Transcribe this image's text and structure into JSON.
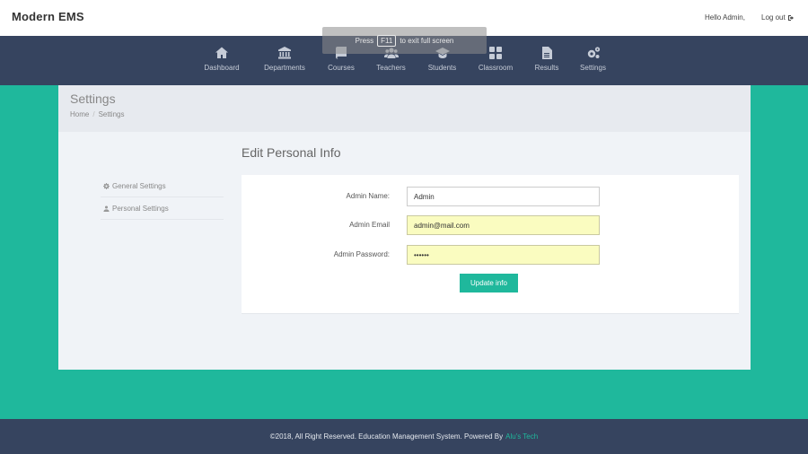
{
  "header": {
    "brand": "Modern EMS",
    "greeting": "Hello Admin,",
    "logout_label": "Log out",
    "logout_icon": "sign-out-icon"
  },
  "fullscreen_tip": {
    "prefix": "Press",
    "key": "F11",
    "suffix": "to exit full screen"
  },
  "nav": {
    "items": [
      {
        "label": "Dashboard",
        "icon": "home-icon"
      },
      {
        "label": "Departments",
        "icon": "institution-icon"
      },
      {
        "label": "Courses",
        "icon": "book-icon"
      },
      {
        "label": "Teachers",
        "icon": "users-icon"
      },
      {
        "label": "Students",
        "icon": "graduation-cap-icon"
      },
      {
        "label": "Classroom",
        "icon": "grid-icon"
      },
      {
        "label": "Results",
        "icon": "file-icon"
      },
      {
        "label": "Settings",
        "icon": "cogs-icon"
      }
    ]
  },
  "page": {
    "title": "Settings",
    "breadcrumb": [
      "Home",
      "/",
      "Settings"
    ]
  },
  "sidebar": {
    "items": [
      {
        "label": "General Settings",
        "icon": "gear-icon"
      },
      {
        "label": "Personal Settings",
        "icon": "user-icon"
      }
    ]
  },
  "form": {
    "title": "Edit Personal Info",
    "name_label": "Admin Name:",
    "name_value": "Admin",
    "email_label": "Admin Email",
    "email_value": "admin@mail.com",
    "password_label": "Admin Password:",
    "password_value": "••••••",
    "submit_label": "Update info"
  },
  "footer": {
    "text": "©2018, All Right Reserved. Education Management System. Powered By",
    "link": "Alu's Tech"
  },
  "colors": {
    "accent": "#1fb89c",
    "navbar": "#36445f",
    "autofill": "#fafcc0"
  }
}
